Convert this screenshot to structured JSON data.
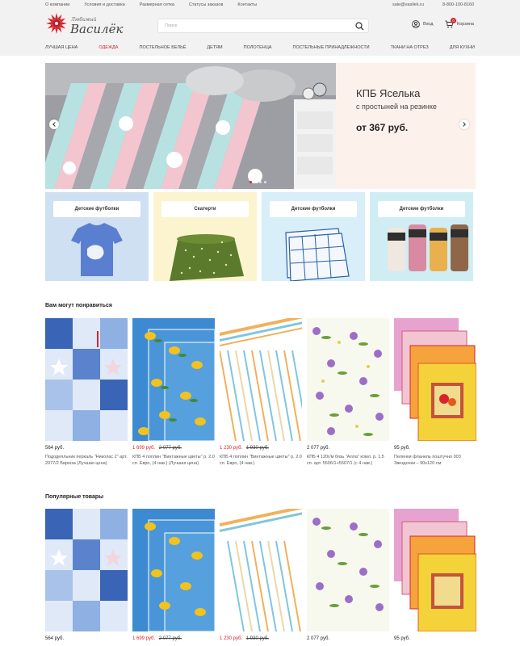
{
  "topbar": {
    "links": [
      "О компании",
      "Условия и доставка",
      "Размерная сетка",
      "Статусы заказов",
      "Контакты"
    ],
    "email": "sale@vasilek.ru",
    "phone": "8-800-100-8160"
  },
  "logo": {
    "small": "Любимый",
    "big": "Василёк"
  },
  "search": {
    "placeholder": "Поиск"
  },
  "account": {
    "login": "Вход",
    "cart": "Корзина",
    "cart_count": "0"
  },
  "nav": {
    "items": [
      "ЛУЧШАЯ ЦЕНА",
      "ОДЕЖДА",
      "ПОСТЕЛЬНОЕ БЕЛЬЁ",
      "ДЕТЯМ",
      "ПОЛОТЕНЦА",
      "ПОСТЕЛЬНЫЕ ПРИНАДЛЕЖНОСТИ",
      "ТКАНИ НА ОТРЕЗ",
      "ДЛЯ КУХНИ"
    ],
    "active_index": 1
  },
  "hero": {
    "title": "КПБ Яселька",
    "subtitle": "с простыней на резинке",
    "price": "от 367 руб.",
    "slide_count": 4,
    "active_slide": 0
  },
  "categories": [
    {
      "label": "Детские футболки",
      "bg": "#cfe0f2"
    },
    {
      "label": "Скатерти",
      "bg": "#fbf4cf"
    },
    {
      "label": "Детские футболки",
      "bg": "#d8eef8"
    },
    {
      "label": "Детские футболки",
      "bg": "#cfeef4"
    }
  ],
  "sections": {
    "recommended": {
      "title": "Вам могут понравиться",
      "products": [
        {
          "price": "564 руб.",
          "old_price": "",
          "name": "Пододеяльник перкаль \"Николас 2\" арт. 2077/2 Бирюза (Лучшая цена)"
        },
        {
          "price": "1 699 руб.",
          "old_price": "2 077 руб.",
          "name": "КПБ 4 поплин \"Винтажные цветы\" р. 2.0 сп. Евро, (4 нав.) (Лучшая цена)"
        },
        {
          "price": "1 230 руб.",
          "old_price": "1 930 руб.",
          "name": "КПБ 4 поплин \"Винтажные цветы\" р. 2.0 сп. Евро, (4 нав.)"
        },
        {
          "price": "2 077 руб.",
          "old_price": "",
          "name": "КПБ 4 120г/м бязь \"Алла\" комл. р. 1.5 сп. арт. 5506/1+5507/1 (с 4 нав.)"
        },
        {
          "price": "95 руб.",
          "old_price": "",
          "name": "Пеленки фланель поштучно 003 Звездочки – 90х120 см"
        }
      ]
    },
    "popular": {
      "title": "Популярные товары",
      "products": [
        {
          "price": "564 руб.",
          "old_price": "",
          "name": ""
        },
        {
          "price": "1 699 руб.",
          "old_price": "2 077 руб.",
          "name": ""
        },
        {
          "price": "1 230 руб.",
          "old_price": "1 930 руб.",
          "name": ""
        },
        {
          "price": "2 077 руб.",
          "old_price": "",
          "name": ""
        },
        {
          "price": "95 руб.",
          "old_price": "",
          "name": ""
        }
      ]
    }
  },
  "colors": {
    "accent": "#d9232d",
    "header_bg": "#f2f2f2"
  }
}
